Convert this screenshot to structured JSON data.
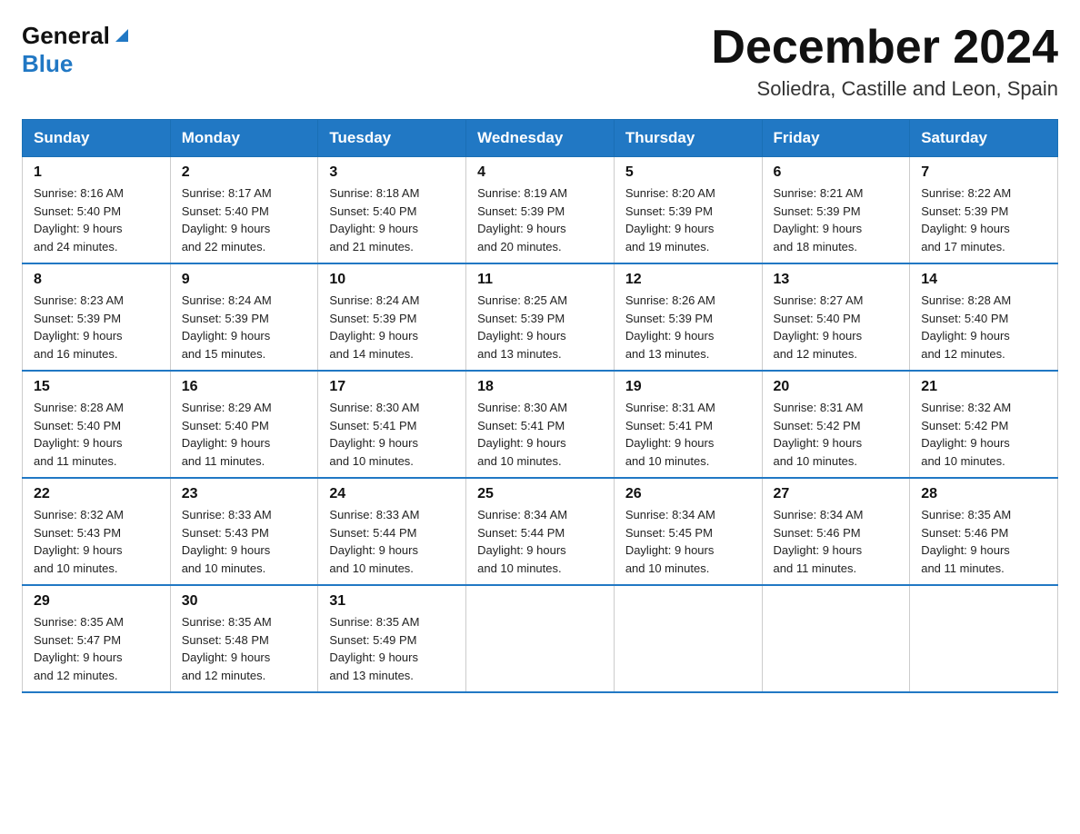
{
  "header": {
    "logo_general": "General",
    "logo_blue": "Blue",
    "month_title": "December 2024",
    "location": "Soliedra, Castille and Leon, Spain"
  },
  "days_of_week": [
    "Sunday",
    "Monday",
    "Tuesday",
    "Wednesday",
    "Thursday",
    "Friday",
    "Saturday"
  ],
  "weeks": [
    [
      {
        "day": "1",
        "sunrise": "8:16 AM",
        "sunset": "5:40 PM",
        "daylight": "9 hours and 24 minutes."
      },
      {
        "day": "2",
        "sunrise": "8:17 AM",
        "sunset": "5:40 PM",
        "daylight": "9 hours and 22 minutes."
      },
      {
        "day": "3",
        "sunrise": "8:18 AM",
        "sunset": "5:40 PM",
        "daylight": "9 hours and 21 minutes."
      },
      {
        "day": "4",
        "sunrise": "8:19 AM",
        "sunset": "5:39 PM",
        "daylight": "9 hours and 20 minutes."
      },
      {
        "day": "5",
        "sunrise": "8:20 AM",
        "sunset": "5:39 PM",
        "daylight": "9 hours and 19 minutes."
      },
      {
        "day": "6",
        "sunrise": "8:21 AM",
        "sunset": "5:39 PM",
        "daylight": "9 hours and 18 minutes."
      },
      {
        "day": "7",
        "sunrise": "8:22 AM",
        "sunset": "5:39 PM",
        "daylight": "9 hours and 17 minutes."
      }
    ],
    [
      {
        "day": "8",
        "sunrise": "8:23 AM",
        "sunset": "5:39 PM",
        "daylight": "9 hours and 16 minutes."
      },
      {
        "day": "9",
        "sunrise": "8:24 AM",
        "sunset": "5:39 PM",
        "daylight": "9 hours and 15 minutes."
      },
      {
        "day": "10",
        "sunrise": "8:24 AM",
        "sunset": "5:39 PM",
        "daylight": "9 hours and 14 minutes."
      },
      {
        "day": "11",
        "sunrise": "8:25 AM",
        "sunset": "5:39 PM",
        "daylight": "9 hours and 13 minutes."
      },
      {
        "day": "12",
        "sunrise": "8:26 AM",
        "sunset": "5:39 PM",
        "daylight": "9 hours and 13 minutes."
      },
      {
        "day": "13",
        "sunrise": "8:27 AM",
        "sunset": "5:40 PM",
        "daylight": "9 hours and 12 minutes."
      },
      {
        "day": "14",
        "sunrise": "8:28 AM",
        "sunset": "5:40 PM",
        "daylight": "9 hours and 12 minutes."
      }
    ],
    [
      {
        "day": "15",
        "sunrise": "8:28 AM",
        "sunset": "5:40 PM",
        "daylight": "9 hours and 11 minutes."
      },
      {
        "day": "16",
        "sunrise": "8:29 AM",
        "sunset": "5:40 PM",
        "daylight": "9 hours and 11 minutes."
      },
      {
        "day": "17",
        "sunrise": "8:30 AM",
        "sunset": "5:41 PM",
        "daylight": "9 hours and 10 minutes."
      },
      {
        "day": "18",
        "sunrise": "8:30 AM",
        "sunset": "5:41 PM",
        "daylight": "9 hours and 10 minutes."
      },
      {
        "day": "19",
        "sunrise": "8:31 AM",
        "sunset": "5:41 PM",
        "daylight": "9 hours and 10 minutes."
      },
      {
        "day": "20",
        "sunrise": "8:31 AM",
        "sunset": "5:42 PM",
        "daylight": "9 hours and 10 minutes."
      },
      {
        "day": "21",
        "sunrise": "8:32 AM",
        "sunset": "5:42 PM",
        "daylight": "9 hours and 10 minutes."
      }
    ],
    [
      {
        "day": "22",
        "sunrise": "8:32 AM",
        "sunset": "5:43 PM",
        "daylight": "9 hours and 10 minutes."
      },
      {
        "day": "23",
        "sunrise": "8:33 AM",
        "sunset": "5:43 PM",
        "daylight": "9 hours and 10 minutes."
      },
      {
        "day": "24",
        "sunrise": "8:33 AM",
        "sunset": "5:44 PM",
        "daylight": "9 hours and 10 minutes."
      },
      {
        "day": "25",
        "sunrise": "8:34 AM",
        "sunset": "5:44 PM",
        "daylight": "9 hours and 10 minutes."
      },
      {
        "day": "26",
        "sunrise": "8:34 AM",
        "sunset": "5:45 PM",
        "daylight": "9 hours and 10 minutes."
      },
      {
        "day": "27",
        "sunrise": "8:34 AM",
        "sunset": "5:46 PM",
        "daylight": "9 hours and 11 minutes."
      },
      {
        "day": "28",
        "sunrise": "8:35 AM",
        "sunset": "5:46 PM",
        "daylight": "9 hours and 11 minutes."
      }
    ],
    [
      {
        "day": "29",
        "sunrise": "8:35 AM",
        "sunset": "5:47 PM",
        "daylight": "9 hours and 12 minutes."
      },
      {
        "day": "30",
        "sunrise": "8:35 AM",
        "sunset": "5:48 PM",
        "daylight": "9 hours and 12 minutes."
      },
      {
        "day": "31",
        "sunrise": "8:35 AM",
        "sunset": "5:49 PM",
        "daylight": "9 hours and 13 minutes."
      },
      null,
      null,
      null,
      null
    ]
  ],
  "labels": {
    "sunrise": "Sunrise:",
    "sunset": "Sunset:",
    "daylight": "Daylight:"
  }
}
